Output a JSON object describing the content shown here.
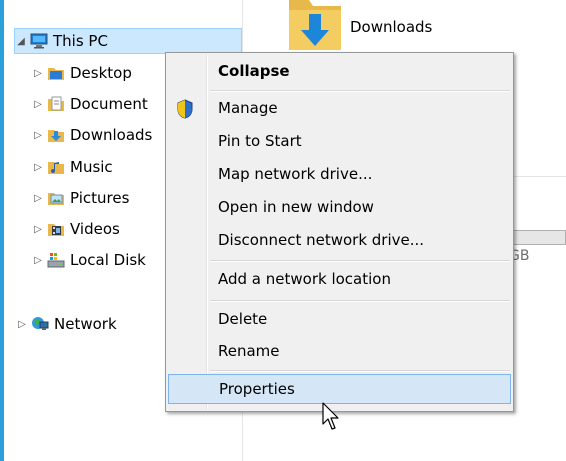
{
  "nav": {
    "this_pc": "This PC",
    "items": [
      {
        "label": "Desktop",
        "icon": "desktop-folder-icon"
      },
      {
        "label": "Document",
        "icon": "documents-folder-icon"
      },
      {
        "label": "Downloads",
        "icon": "downloads-folder-icon"
      },
      {
        "label": "Music",
        "icon": "music-folder-icon"
      },
      {
        "label": "Pictures",
        "icon": "pictures-folder-icon"
      },
      {
        "label": "Videos",
        "icon": "videos-folder-icon"
      },
      {
        "label": "Local Disk",
        "icon": "local-disk-icon"
      }
    ],
    "network": "Network"
  },
  "content": {
    "downloads_label": "Downloads",
    "disk_free_fragment": "GB"
  },
  "context_menu": {
    "items": [
      {
        "label": "Collapse",
        "bold": true
      },
      {
        "label": "Manage",
        "icon": "uac-shield-icon"
      },
      {
        "label": "Pin to Start"
      },
      {
        "label": "Map network drive..."
      },
      {
        "label": "Open in new window"
      },
      {
        "label": "Disconnect network drive..."
      },
      {
        "label": "Add a network location"
      },
      {
        "label": "Delete"
      },
      {
        "label": "Rename"
      },
      {
        "label": "Properties",
        "highlighted": true
      }
    ]
  },
  "colors": {
    "accent": "#2aa0d8",
    "selection": "#cce8ff",
    "menu_background": "#f0f0f0",
    "menu_highlight": "#d5e6f7"
  }
}
